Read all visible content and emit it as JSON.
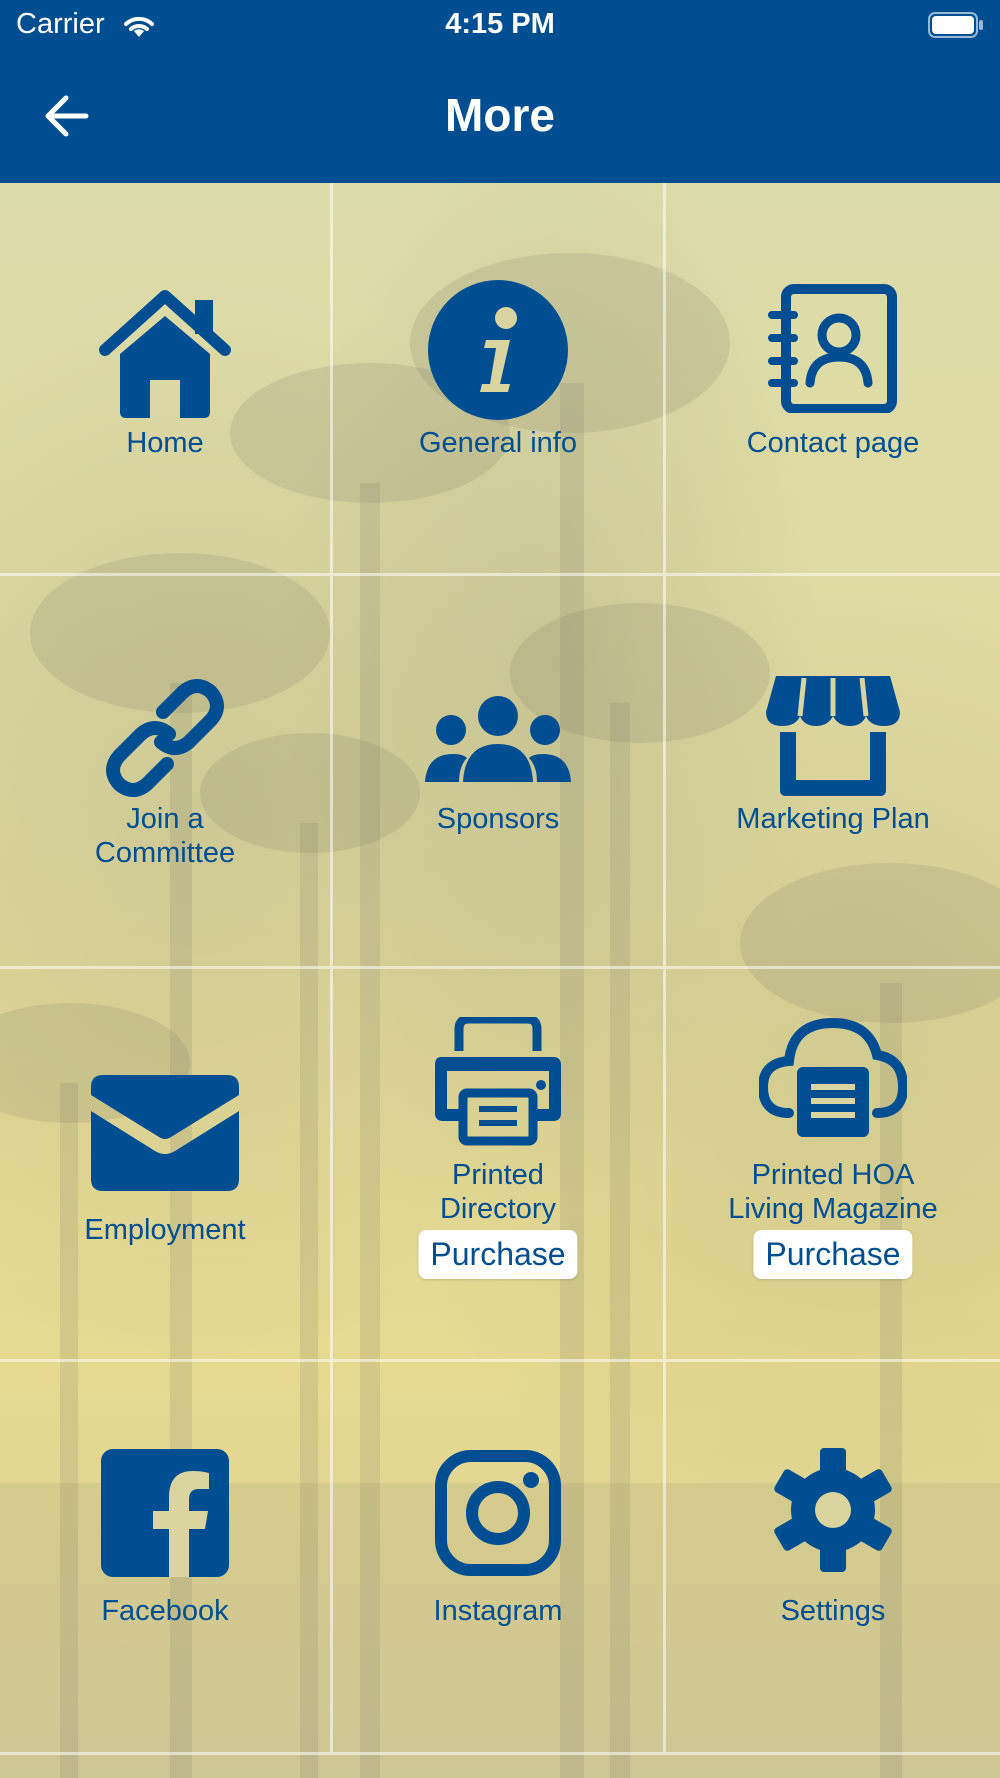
{
  "status_bar": {
    "carrier": "Carrier",
    "time": "4:15 PM"
  },
  "nav": {
    "title": "More"
  },
  "tiles": {
    "home": "Home",
    "general_info": "General info",
    "contact_page": "Contact page",
    "join_committee_line1": "Join a",
    "join_committee_line2": "Committee",
    "sponsors": "Sponsors",
    "marketing_plan": "Marketing Plan",
    "employment": "Employment",
    "printed_directory_line1": "Printed",
    "printed_directory_line2": "Directory",
    "printed_directory_button": "Purchase",
    "magazine_line1": "Printed HOA",
    "magazine_line2": "Living Magazine",
    "magazine_button": "Purchase",
    "facebook": "Facebook",
    "instagram": "Instagram",
    "settings": "Settings"
  },
  "colors": {
    "brand": "#004e92",
    "tile_bg": "#dcd8a0",
    "button_bg": "#ffffff"
  }
}
